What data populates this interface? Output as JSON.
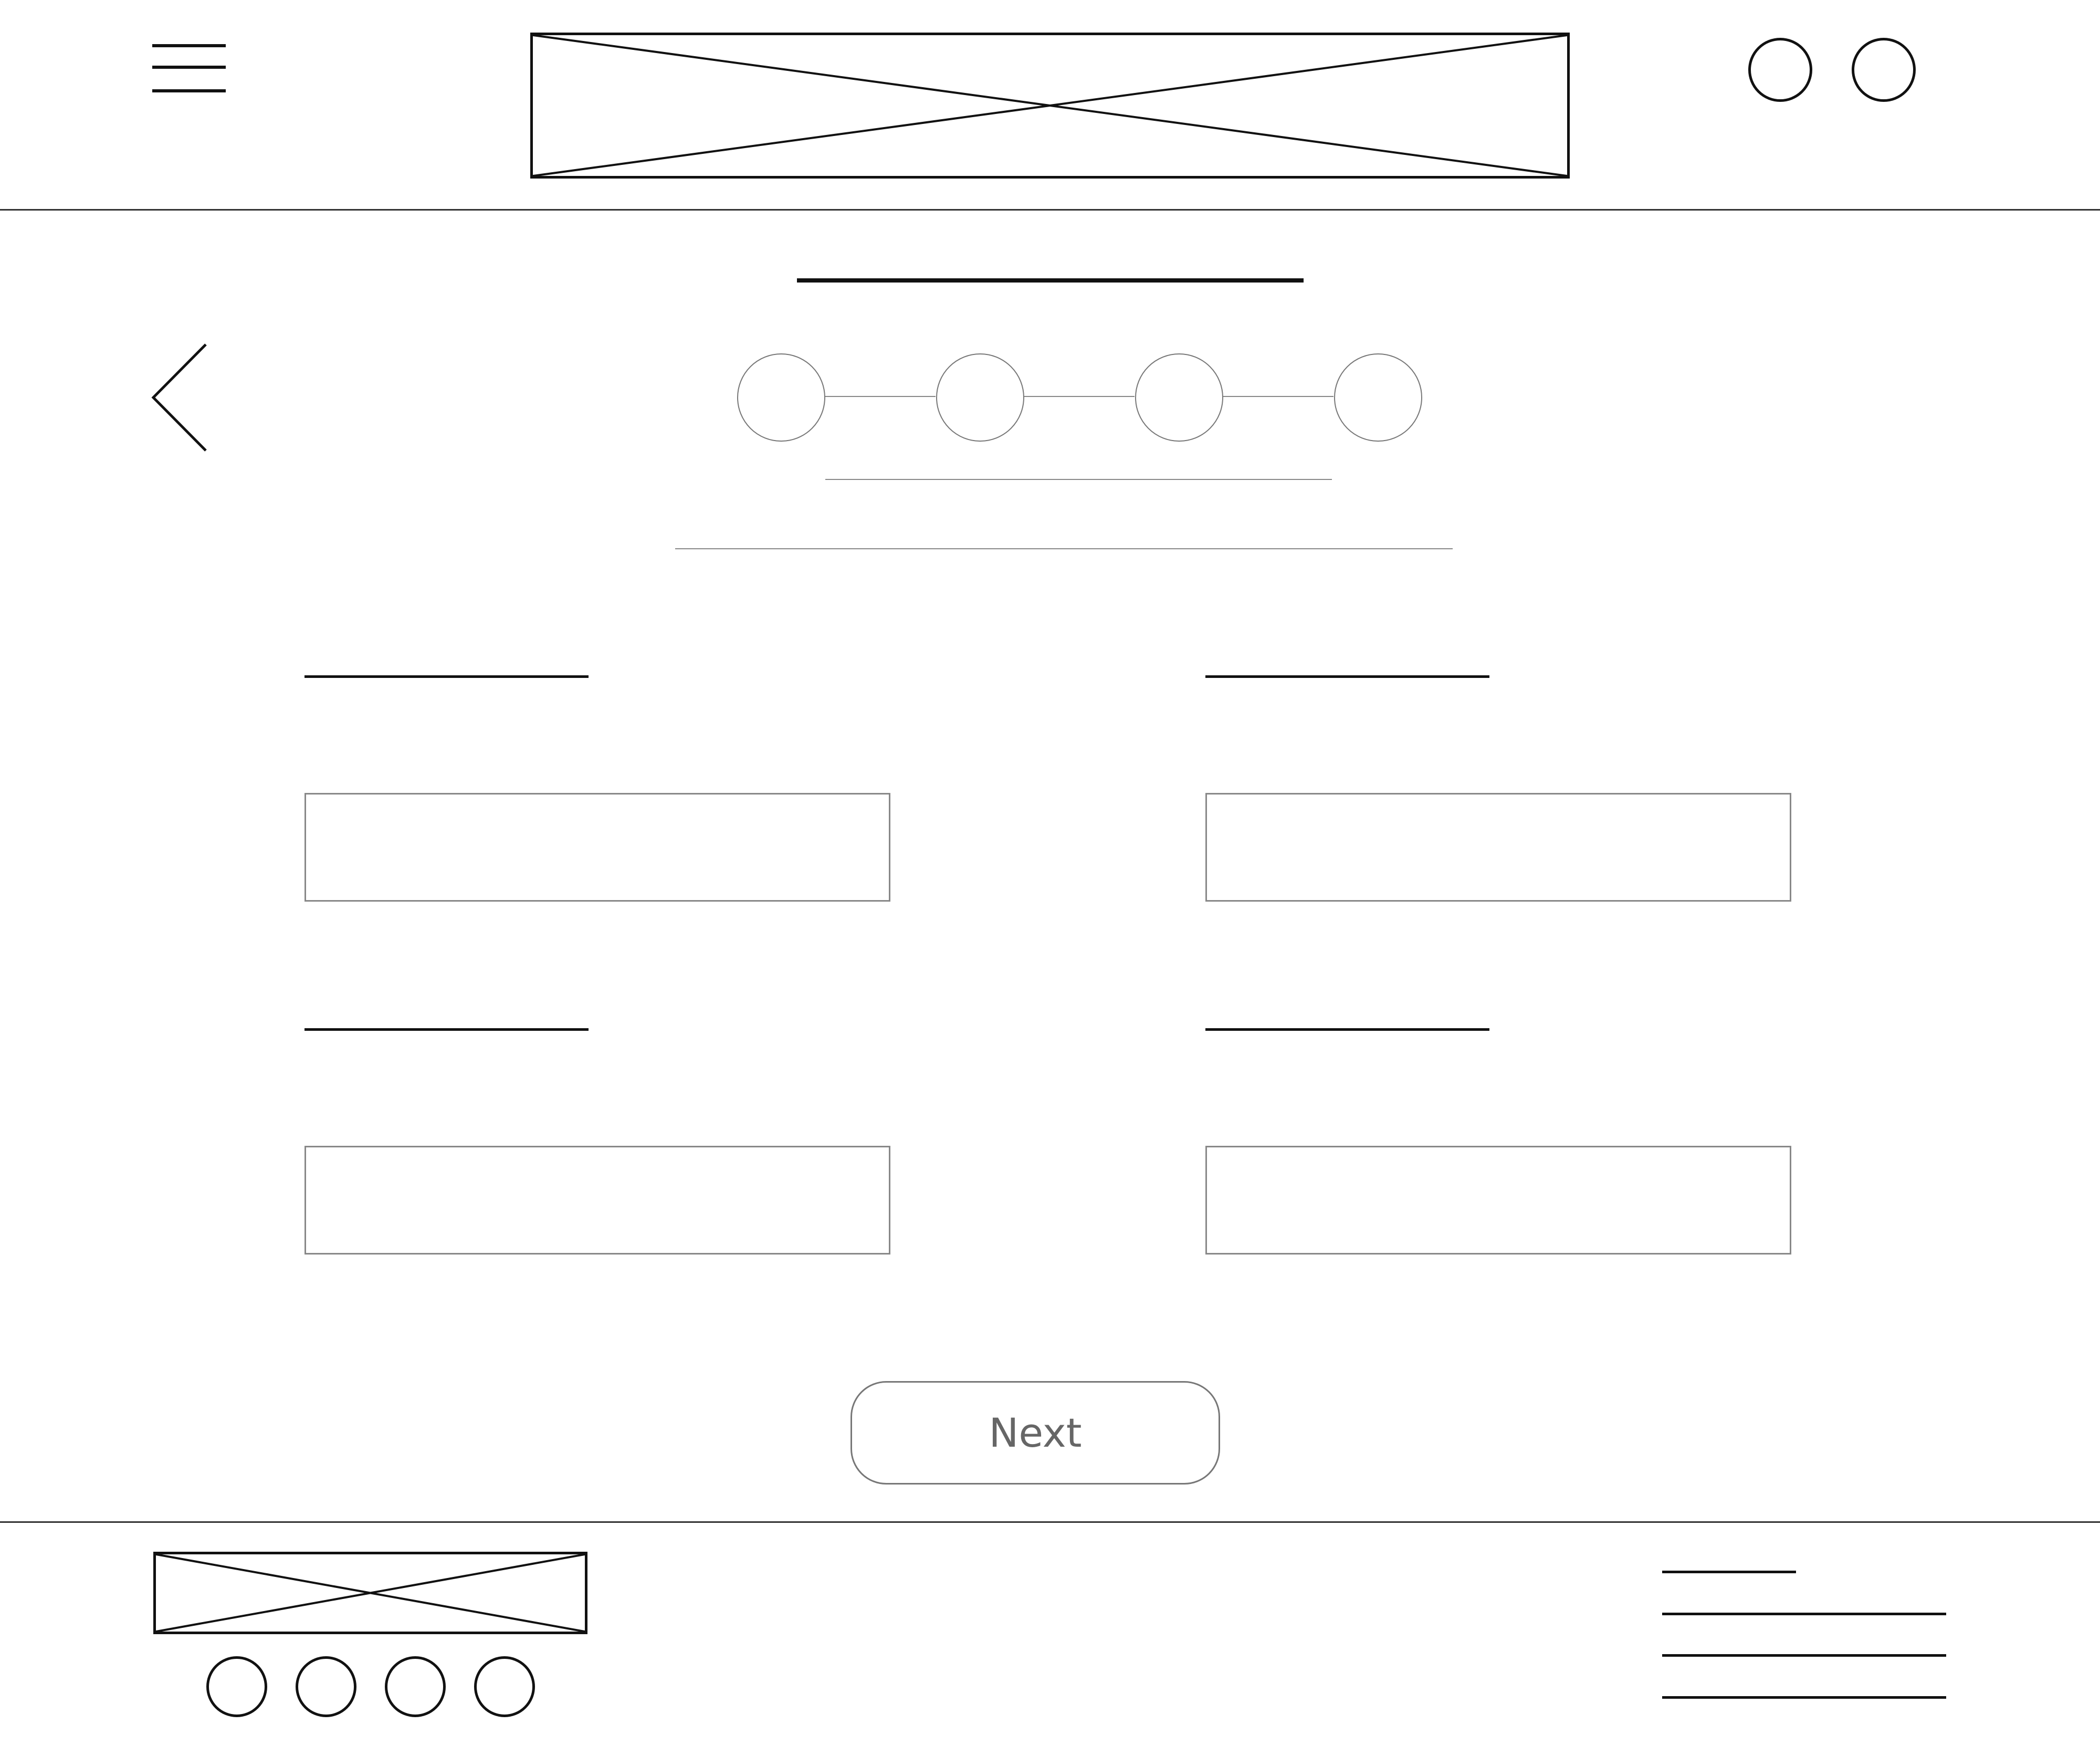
{
  "header": {
    "menu_icon": "hamburger-menu-icon",
    "logo": "image-placeholder",
    "actions": [
      "circle-icon",
      "circle-icon"
    ]
  },
  "main": {
    "back_icon": "chevron-left-icon",
    "stepper": {
      "total_steps": 4
    },
    "next_button_label": "Next"
  },
  "footer": {
    "logo": "image-placeholder",
    "social_icons": [
      "circle-icon",
      "circle-icon",
      "circle-icon",
      "circle-icon"
    ],
    "links_count": 4
  },
  "colors": {
    "stroke": "#111111",
    "muted_stroke": "#888888",
    "button_text": "#666666",
    "background": "#ffffff"
  }
}
